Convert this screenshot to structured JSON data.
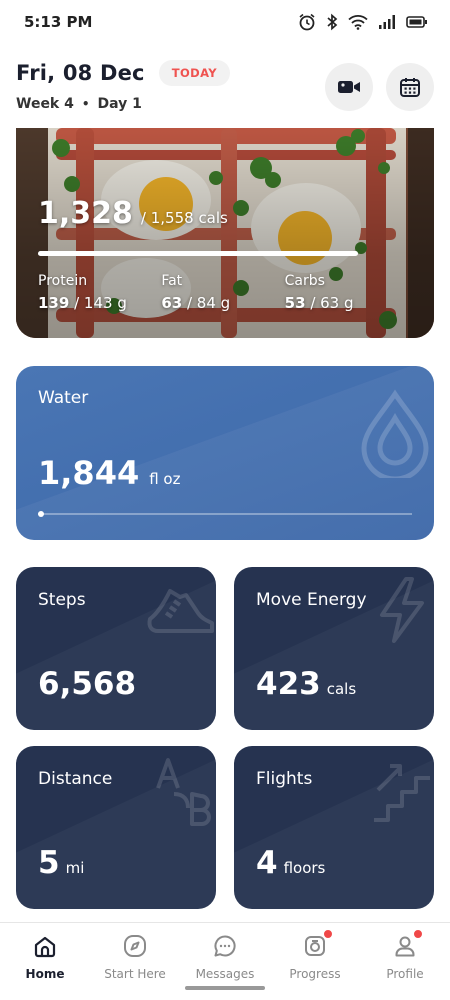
{
  "status_bar": {
    "time": "5:13 PM",
    "icons": [
      "alarm-icon",
      "bluetooth-icon",
      "wifi-icon",
      "signal-icon",
      "battery-icon"
    ]
  },
  "header": {
    "date": "Fri, 08 Dec",
    "today_badge": "TODAY",
    "week": "Week 4",
    "separator": "•",
    "day": "Day 1",
    "buttons": [
      "video-camera-icon",
      "calendar-icon"
    ]
  },
  "calories": {
    "consumed": "1,328",
    "goal_text": "/ 1,558 cals",
    "progress_fraction": 0.85,
    "macros": [
      {
        "label": "Protein",
        "value": "139",
        "goal": "/ 143 g"
      },
      {
        "label": "Fat",
        "value": "63",
        "goal": "/ 84 g"
      },
      {
        "label": "Carbs",
        "value": "53",
        "goal": "/ 63 g"
      }
    ]
  },
  "water": {
    "title": "Water",
    "value": "1,844",
    "unit": "fl oz",
    "progress_fraction": 0.0,
    "color": "#4a76b4"
  },
  "tiles": {
    "steps": {
      "title": "Steps",
      "value": "6,568",
      "unit": ""
    },
    "move": {
      "title": "Move Energy",
      "value": "423",
      "unit": "cals"
    },
    "distance": {
      "title": "Distance",
      "value": "5",
      "unit": "mi"
    },
    "flights": {
      "title": "Flights",
      "value": "4",
      "unit": "floors"
    },
    "color": "#263350"
  },
  "nav": {
    "items": [
      {
        "label": "Home",
        "icon": "home-icon",
        "active": true
      },
      {
        "label": "Start Here",
        "icon": "compass-icon",
        "active": false
      },
      {
        "label": "Messages",
        "icon": "chat-icon",
        "active": false
      },
      {
        "label": "Progress",
        "icon": "progress-icon",
        "active": false,
        "badge": true
      },
      {
        "label": "Profile",
        "icon": "profile-icon",
        "active": false,
        "badge": true
      }
    ],
    "badge_color": "#f04848"
  }
}
